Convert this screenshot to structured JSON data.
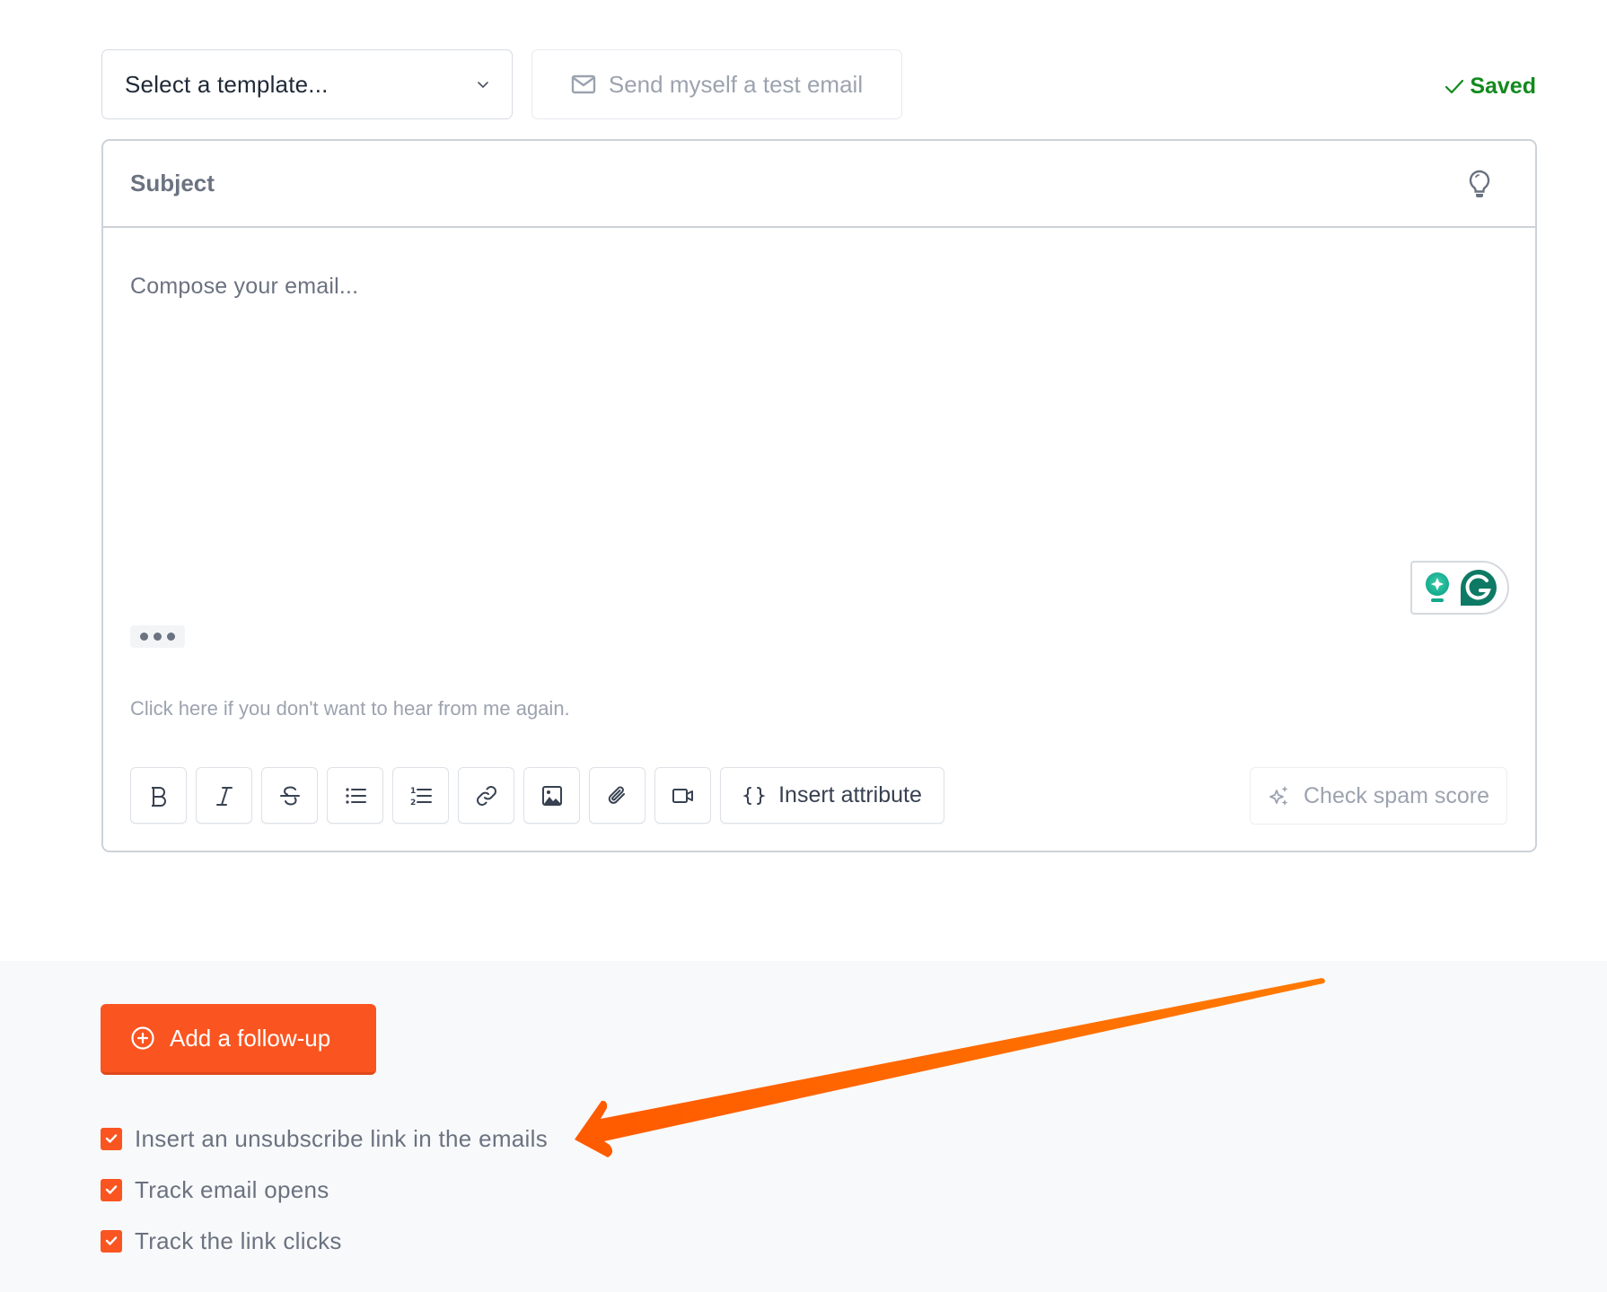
{
  "top_bar": {
    "template_select": {
      "value": "Select a template...",
      "icon": "chevron-down-icon"
    },
    "test_email_button": {
      "label": "Send myself a test email",
      "icon": "mail-icon"
    },
    "save_status": {
      "label": "Saved",
      "icon": "check-icon",
      "color": "#138a1e"
    }
  },
  "editor": {
    "subject_placeholder": "Subject",
    "subject_icon": "lightbulb-icon",
    "body_placeholder": "Compose your email...",
    "more_button_icon": "ellipsis-icon",
    "unsubscribe_text": "Click here if you don't want to hear from me again.",
    "grammarly_widget": {
      "icons": [
        "grammarly-suggestion-icon",
        "grammarly-logo-icon"
      ],
      "color": "#0e7a65"
    },
    "toolbar": {
      "buttons": [
        {
          "name": "bold",
          "icon": "bold-icon"
        },
        {
          "name": "italic",
          "icon": "italic-icon"
        },
        {
          "name": "strikethrough",
          "icon": "strikethrough-icon"
        },
        {
          "name": "bullet-list",
          "icon": "bullet-list-icon"
        },
        {
          "name": "numbered-list",
          "icon": "numbered-list-icon"
        },
        {
          "name": "link",
          "icon": "link-icon"
        },
        {
          "name": "image",
          "icon": "image-icon"
        },
        {
          "name": "attachment",
          "icon": "paperclip-icon"
        },
        {
          "name": "video",
          "icon": "video-icon"
        }
      ],
      "insert_attribute_label": "Insert attribute",
      "insert_attribute_icon": "curly-braces-icon",
      "spam_check_label": "Check spam score",
      "spam_check_icon": "sparkles-icon"
    }
  },
  "bottom": {
    "follow_up_button": {
      "label": "Add a follow-up",
      "icon": "plus-circle-icon",
      "color": "#fa5521"
    },
    "options": [
      {
        "label": "Insert an unsubscribe link in the emails",
        "checked": true
      },
      {
        "label": "Track email opens",
        "checked": true
      },
      {
        "label": "Track the link clicks",
        "checked": true
      }
    ]
  },
  "annotation": {
    "type": "arrow",
    "color": "#ff6a00",
    "points_to": "Insert an unsubscribe link in the emails"
  }
}
